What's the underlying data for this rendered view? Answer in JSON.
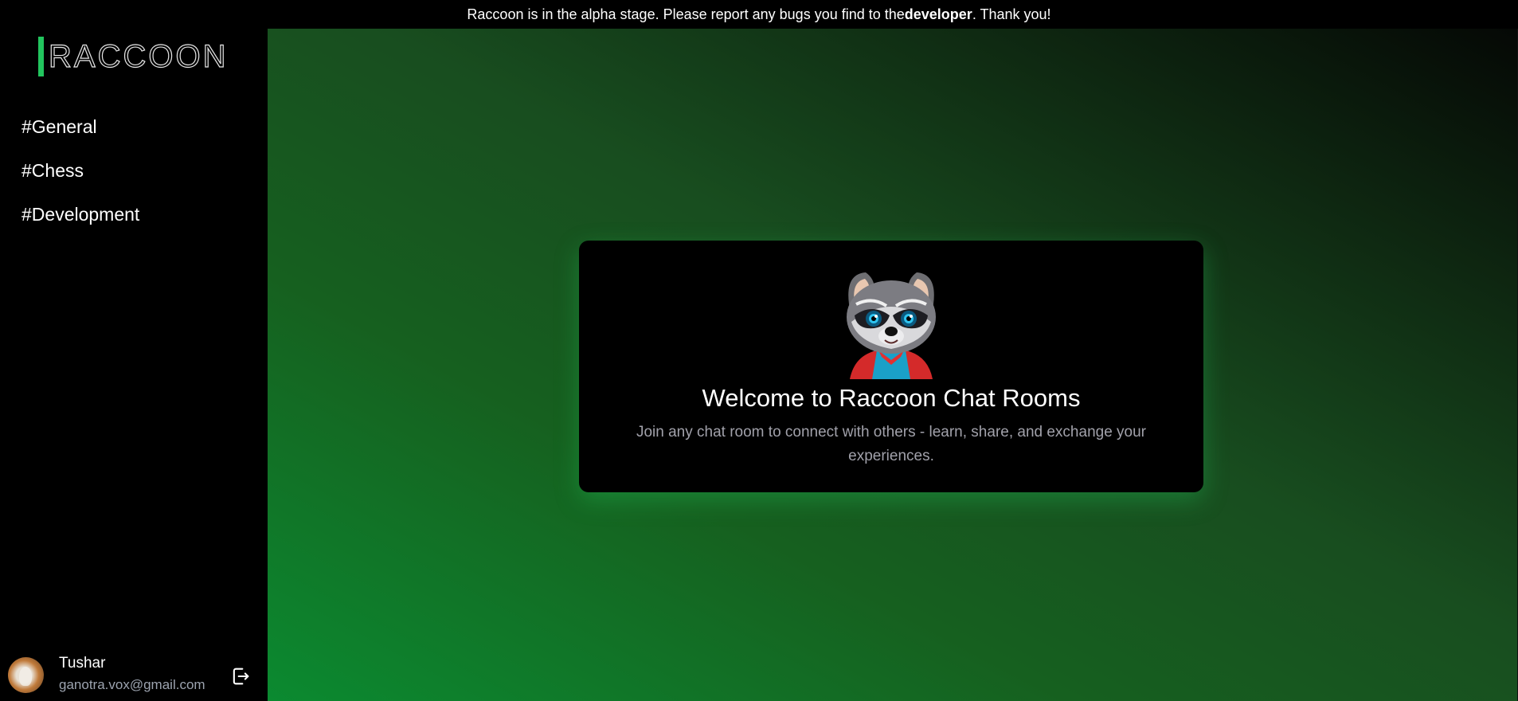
{
  "banner": {
    "text_before": "Raccoon is in the alpha stage. Please report any bugs you find to the ",
    "link_text": "developer",
    "text_after": ". Thank you!"
  },
  "sidebar": {
    "logo_text": "RACCOON",
    "rooms": [
      {
        "label": "#General"
      },
      {
        "label": "#Chess"
      },
      {
        "label": "#Development"
      }
    ],
    "user": {
      "name": "Tushar",
      "email": "ganotra.vox@gmail.com"
    }
  },
  "welcome": {
    "title": "Welcome to Raccoon Chat Rooms",
    "subtitle": "Join any chat room to connect with others - learn, share, and exchange your experiences."
  },
  "icons": {
    "logout": "logout-icon",
    "avatar": "avatar",
    "mascot": "raccoon-mascot"
  },
  "colors": {
    "accent": "#22c55e",
    "sidebar_bg": "#000000",
    "card_bg": "#000000",
    "muted_text": "#a1a1aa"
  }
}
